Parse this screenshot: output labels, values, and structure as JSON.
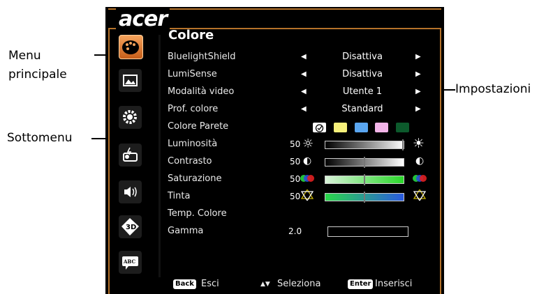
{
  "annotations": {
    "menu_principale": [
      "Menu",
      "principale"
    ],
    "sottomenu": "Sottomenu",
    "impostazioni": "Impostazioni"
  },
  "osd": {
    "logo": "acer",
    "title": "Colore",
    "sidebar_icons": [
      "palette-icon",
      "image-icon",
      "gear-icon",
      "projector-icon",
      "speaker-icon",
      "3d-icon",
      "abc-language-icon"
    ],
    "rows": [
      {
        "label": "BluelightShield",
        "value": "Disattiva"
      },
      {
        "label": "LumiSense",
        "value": "Disattiva"
      },
      {
        "label": "Modalità video",
        "value": "Utente 1"
      },
      {
        "label": "Prof. colore",
        "value": "Standard"
      },
      {
        "label": "Colore Parete"
      },
      {
        "label": "Luminosità",
        "number": "50",
        "level": 1.0
      },
      {
        "label": "Contrasto",
        "number": "50",
        "level": 0.5
      },
      {
        "label": "Saturazione",
        "number": "50",
        "level": 0.5
      },
      {
        "label": "Tinta",
        "number": "50",
        "level": 0.5
      },
      {
        "label": "Temp. Colore"
      },
      {
        "label": "Gamma",
        "number": "2.0"
      }
    ],
    "wall_colors": [
      "#ffffff",
      "#f6f07a",
      "#5aa6f0",
      "#f2b4e8",
      "#0c5a2c"
    ],
    "footer": {
      "back_key": "Back",
      "back_label": "Esci",
      "select_label": "Seleziona",
      "enter_key": "Enter",
      "enter_label": "Inserisci"
    }
  }
}
